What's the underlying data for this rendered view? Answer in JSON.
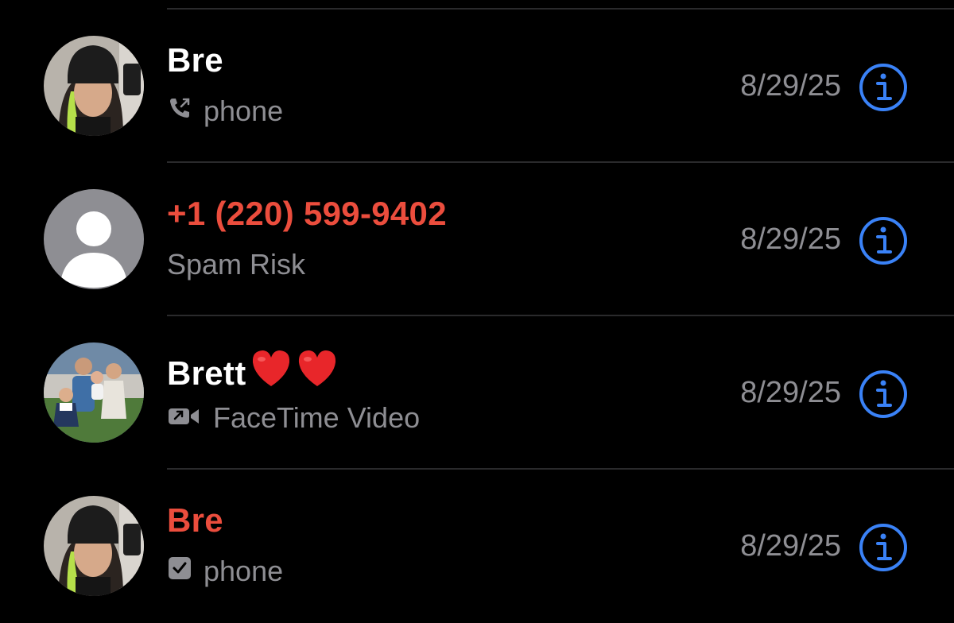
{
  "accent_color": "#3a82f7",
  "missed_color": "#eb4d3d",
  "secondary_text_color": "#8e8e93",
  "calls": [
    {
      "name": "Bre",
      "name_missed": false,
      "subtitle": "phone",
      "subtitle_icon": "outgoing-phone-icon",
      "date": "8/29/25",
      "avatar": "photo-avatar"
    },
    {
      "name": "+1 (220) 599-9402",
      "name_missed": true,
      "subtitle": "Spam Risk",
      "subtitle_icon": "",
      "date": "8/29/25",
      "avatar": "placeholder-avatar"
    },
    {
      "name": "Brett",
      "name_suffix_icons": [
        "red-heart-emoji",
        "red-heart-emoji"
      ],
      "name_missed": false,
      "subtitle": "FaceTime Video",
      "subtitle_icon": "video-camera-icon",
      "date": "8/29/25",
      "avatar": "family-photo-avatar"
    },
    {
      "name": "Bre",
      "name_missed": true,
      "subtitle": "phone",
      "subtitle_icon": "checkmark-box-icon",
      "date": "8/29/25",
      "avatar": "photo-avatar"
    }
  ]
}
